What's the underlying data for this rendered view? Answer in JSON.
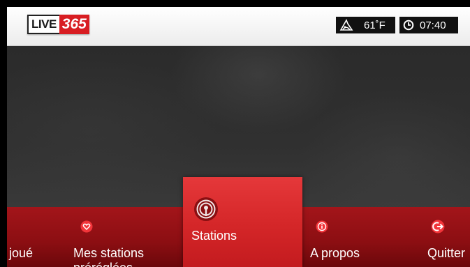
{
  "header": {
    "logo_live": "LIVE",
    "logo_num": "365",
    "temperature": "61˚F",
    "time": "07:40",
    "weather_icon": "weather-icon",
    "clock_icon": "clock-icon"
  },
  "menu": {
    "items": [
      {
        "label": "joué",
        "icon": ""
      },
      {
        "label_line1": "Mes stations",
        "label_line2": "préréglées",
        "icon": "heart-icon"
      },
      {
        "label": "Stations",
        "icon": "antenna-icon",
        "selected": true
      },
      {
        "label": "A propos",
        "icon": "info-icon"
      },
      {
        "label": "Quitter",
        "icon": "exit-arrow-icon"
      }
    ]
  },
  "colors": {
    "brand_red": "#d81d22",
    "menu_red": "#8b0e12",
    "selected_red": "#d42628"
  }
}
